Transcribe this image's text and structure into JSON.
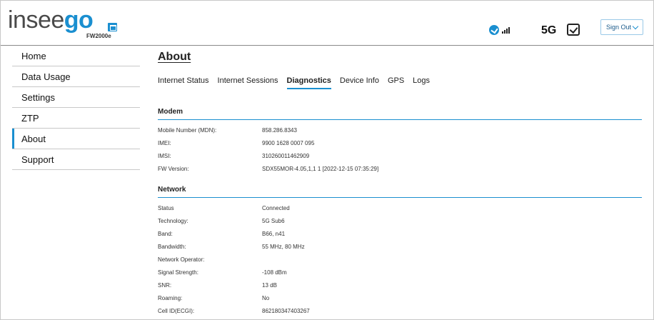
{
  "header": {
    "logo_part1": "insee",
    "logo_part2": "go",
    "model": "FW2000e",
    "network_type": "5G",
    "signout_label": "Sign Out"
  },
  "sidebar": {
    "items": [
      {
        "label": "Home"
      },
      {
        "label": "Data Usage"
      },
      {
        "label": "Settings"
      },
      {
        "label": "ZTP"
      },
      {
        "label": "About"
      },
      {
        "label": "Support"
      }
    ],
    "active": "About"
  },
  "main": {
    "title": "About",
    "tabs": [
      {
        "label": "Internet Status"
      },
      {
        "label": "Internet Sessions"
      },
      {
        "label": "Diagnostics"
      },
      {
        "label": "Device Info"
      },
      {
        "label": "GPS"
      },
      {
        "label": "Logs"
      }
    ],
    "active_tab": "Diagnostics",
    "modem": {
      "heading": "Modem",
      "rows": [
        {
          "key": "Mobile Number (MDN):",
          "value": "858.286.8343"
        },
        {
          "key": "IMEI:",
          "value": "9900 1628 0007 095"
        },
        {
          "key": "IMSI:",
          "value": "310260011462909"
        },
        {
          "key": "FW Version:",
          "value": "SDX55MOR-4.05,1,1 1 [2022-12-15 07:35:29]"
        }
      ]
    },
    "network": {
      "heading": "Network",
      "rows": [
        {
          "key": "Status",
          "value": "Connected"
        },
        {
          "key": "Technology:",
          "value": "5G Sub6"
        },
        {
          "key": "Band:",
          "value": "B66, n41"
        },
        {
          "key": "Bandwidth:",
          "value": "55 MHz, 80 MHz"
        },
        {
          "key": "Network Operator:",
          "value": ""
        },
        {
          "key": "Signal Strength:",
          "value": "-108 dBm"
        },
        {
          "key": "SNR:",
          "value": "13 dB"
        },
        {
          "key": "Roaming:",
          "value": "No"
        },
        {
          "key": "Cell ID(ECGI):",
          "value": "862180347403267"
        }
      ]
    }
  },
  "colors": {
    "accent": "#1a8fd0",
    "border": "#c8c8c8"
  }
}
